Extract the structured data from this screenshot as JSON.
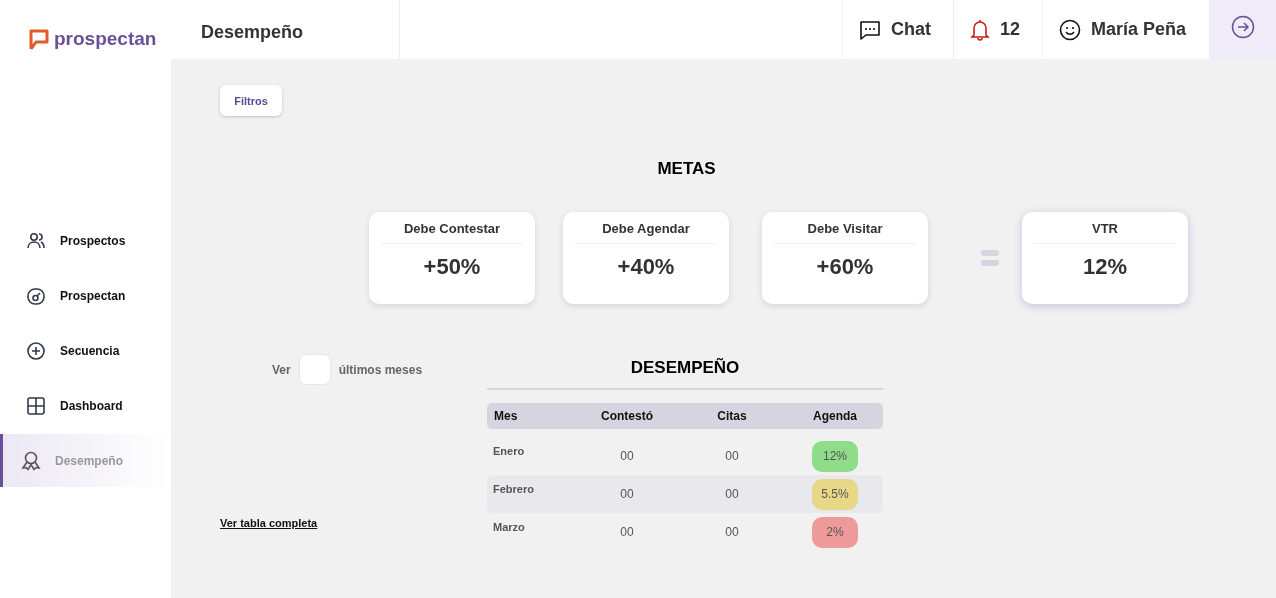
{
  "brand": {
    "name": "prospectan"
  },
  "header": {
    "title": "Desempeño",
    "chat": "Chat",
    "notifications": "12",
    "user": "María Peña"
  },
  "sidebar": {
    "items": [
      {
        "label": "Prospectos",
        "kind": "users",
        "selected": false
      },
      {
        "label": "Prospectan",
        "kind": "gauge",
        "selected": false
      },
      {
        "label": "Secuencia",
        "kind": "plus",
        "selected": false
      },
      {
        "label": "Dashboard",
        "kind": "grid",
        "selected": false
      },
      {
        "label": "Desempeño",
        "kind": "award",
        "selected": true
      }
    ]
  },
  "filters_button": "Filtros",
  "goals": {
    "title": "METAS",
    "cards": [
      {
        "label": "Debe Contestar",
        "value": "+50%",
        "kind": "goal"
      },
      {
        "label": "Debe Agendar",
        "value": "+40%",
        "kind": "goal"
      },
      {
        "label": "Debe Visitar",
        "value": "+60%",
        "kind": "goal"
      },
      {
        "label": "VTR",
        "value": "12%",
        "kind": "result"
      }
    ]
  },
  "months_filter": {
    "before": "Ver",
    "after": "últimos meses"
  },
  "full_table_link": "Ver tabla completa",
  "performance": {
    "title": "DESEMPEÑO",
    "columns": [
      "Mes",
      "Contestó",
      "Citas",
      "Agenda"
    ],
    "rows": [
      {
        "month": "Enero",
        "answered": "00",
        "meetings": "00",
        "agenda": "12%",
        "color": "#8fdd88"
      },
      {
        "month": "Febrero",
        "answered": "00",
        "meetings": "00",
        "agenda": "5.5%",
        "color": "#e8d787"
      },
      {
        "month": "Marzo",
        "answered": "00",
        "meetings": "00",
        "agenda": "2%",
        "color": "#ef9a9a"
      }
    ]
  }
}
